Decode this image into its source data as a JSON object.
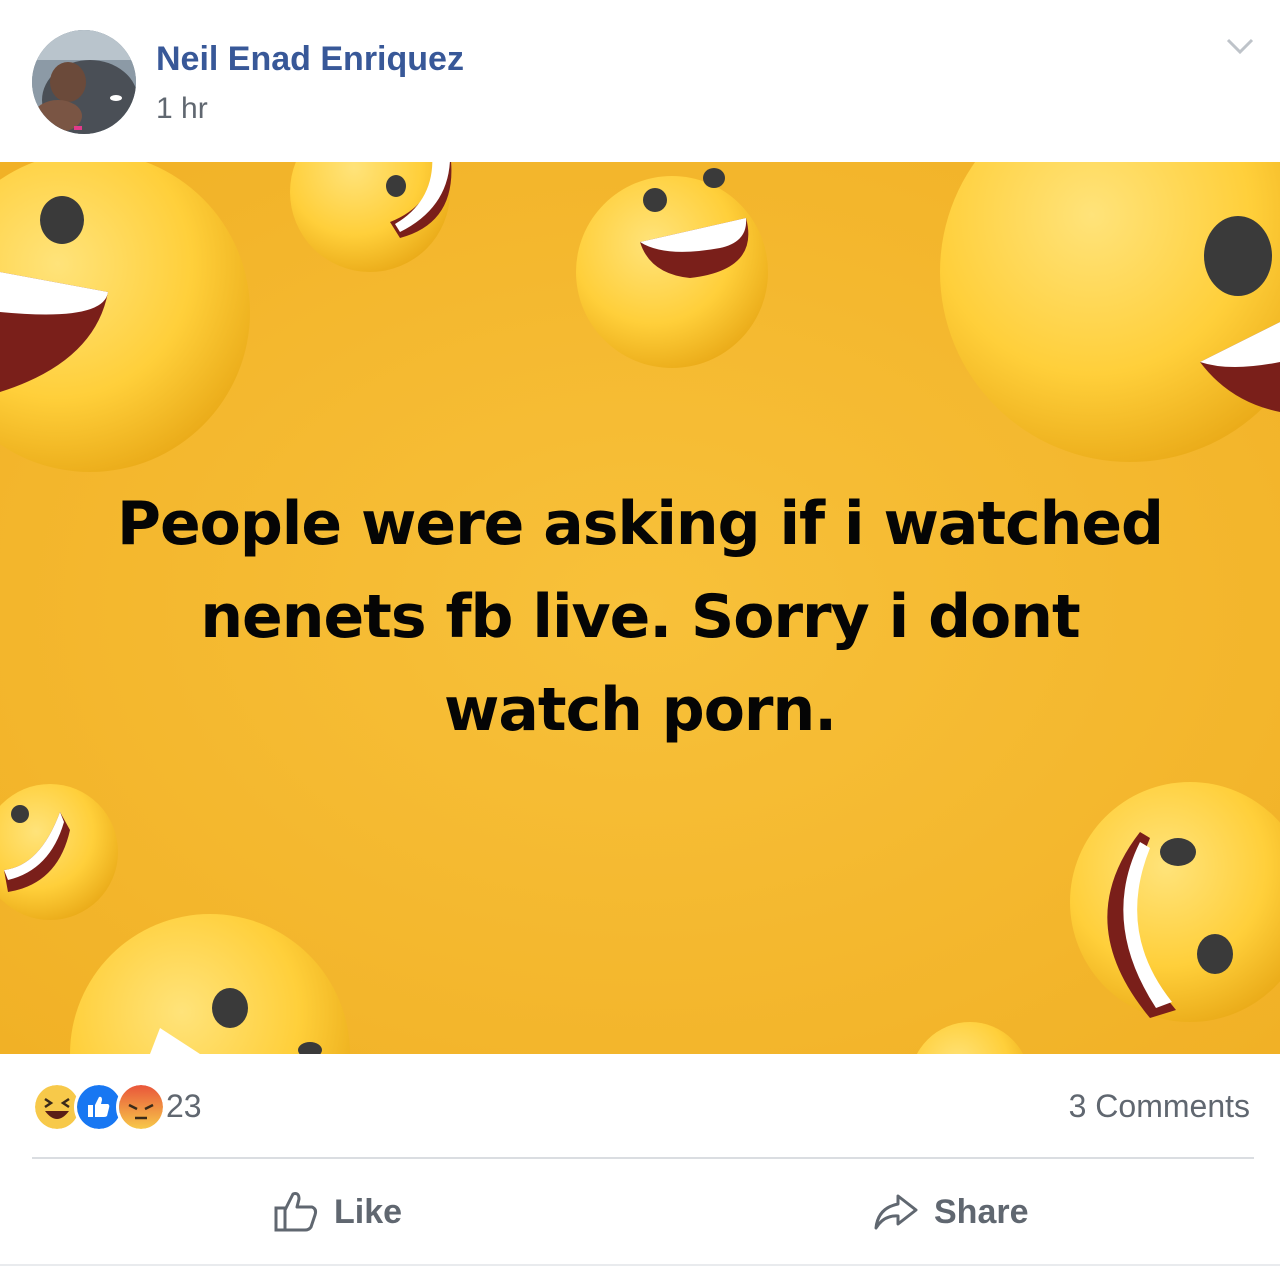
{
  "post": {
    "author": "Neil Enad Enriquez",
    "timestamp": "1 hr",
    "message_lines": [
      "People were asking if i watched",
      "nenets fb live. Sorry i dont",
      "watch porn."
    ],
    "background_color": "#f5b82e"
  },
  "reactions": {
    "icons": [
      "haha-icon",
      "like-icon",
      "angry-icon"
    ],
    "count": "23"
  },
  "comments_label": "3 Comments",
  "actions": {
    "like_label": "Like",
    "share_label": "Share"
  },
  "colors": {
    "author_link": "#385898",
    "secondary_text": "#606770",
    "like_blue": "#1877f2"
  }
}
